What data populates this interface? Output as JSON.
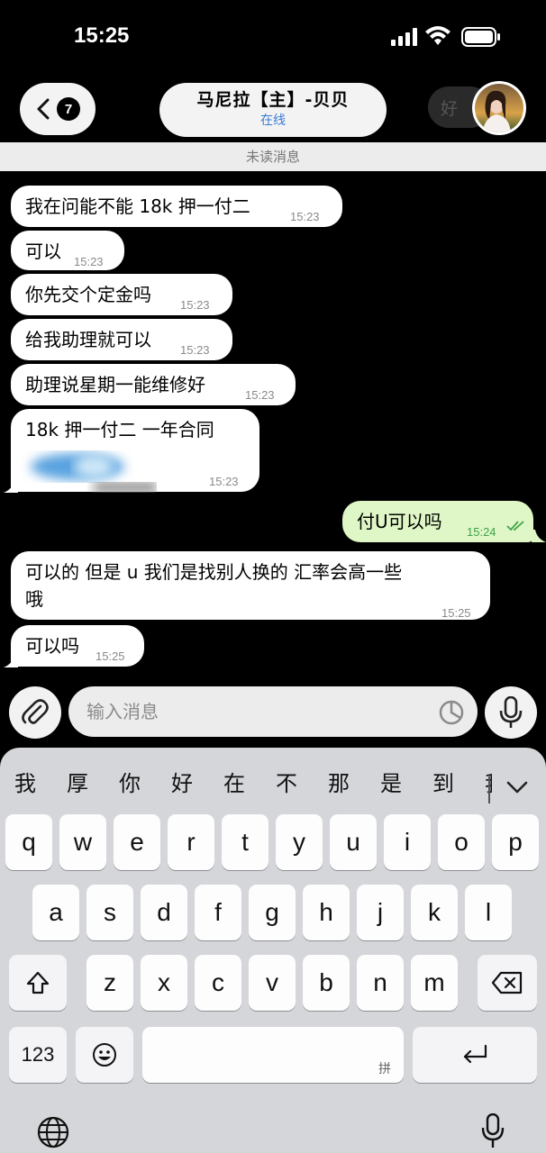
{
  "status_bar": {
    "time": "15:25"
  },
  "header": {
    "unread_count": "7",
    "title": "马尼拉【主】-贝贝",
    "status": "在线",
    "suggestion": "好"
  },
  "unread_divider": "未读消息",
  "messages": [
    {
      "text": "我在问能不能 18k 押一付二",
      "time": "15:23"
    },
    {
      "text": "可以",
      "time": "15:23"
    },
    {
      "text": "你先交个定金吗",
      "time": "15:23"
    },
    {
      "text": "给我助理就可以",
      "time": "15:23"
    },
    {
      "text": "助理说星期一能维修好",
      "time": "15:23"
    },
    {
      "text": "18k 押一付二  一年合同",
      "time": "15:23"
    },
    {
      "text": "付U可以吗",
      "time": "15:24"
    },
    {
      "text_line1": "可以的  但是 u 我们是找别人换的  汇率会高一些",
      "text_line2": "哦",
      "time": "15:25"
    },
    {
      "text": "可以吗",
      "time": "15:25"
    }
  ],
  "composer": {
    "placeholder": "输入消息"
  },
  "keyboard": {
    "candidates": [
      "我",
      "厚",
      "你",
      "好",
      "在",
      "不",
      "那",
      "是",
      "到",
      "我"
    ],
    "row1": [
      "q",
      "w",
      "e",
      "r",
      "t",
      "y",
      "u",
      "i",
      "o",
      "p"
    ],
    "row2": [
      "a",
      "s",
      "d",
      "f",
      "g",
      "h",
      "j",
      "k",
      "l"
    ],
    "row3": [
      "z",
      "x",
      "c",
      "v",
      "b",
      "n",
      "m"
    ],
    "numbers_key": "123",
    "space_hint": "拼"
  },
  "colors": {
    "background": "#000000",
    "incoming_bubble": "#ffffff",
    "outgoing_bubble": "#dff7c6",
    "status_online": "#3a7bd5",
    "read_check": "#3ea34a"
  }
}
